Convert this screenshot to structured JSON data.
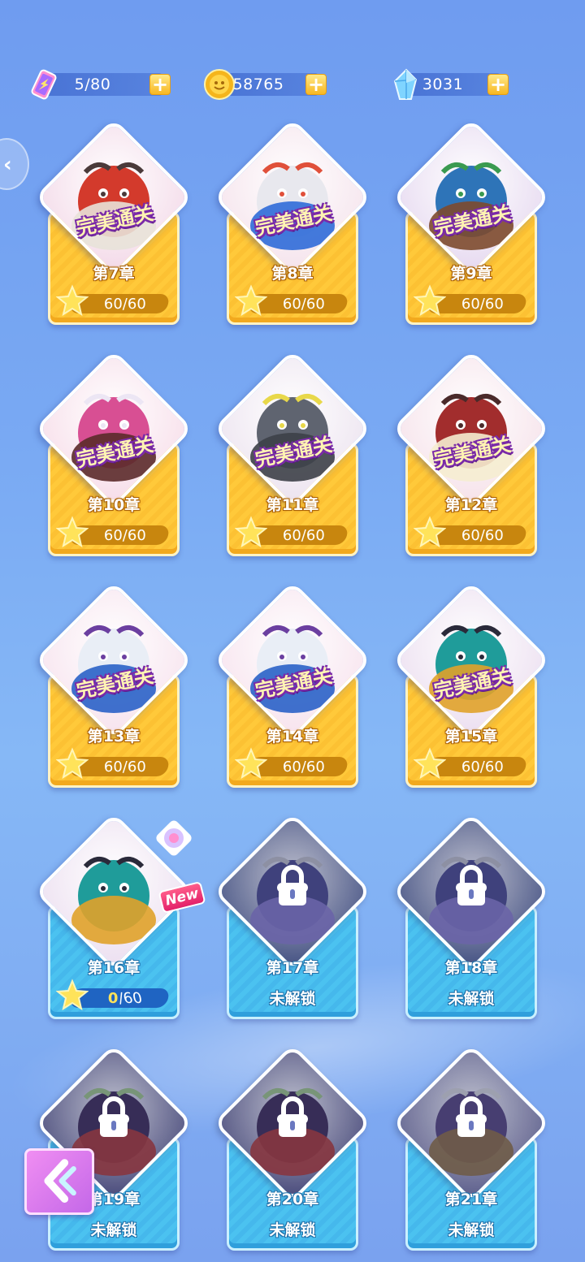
{
  "resources": {
    "energy": {
      "value": "5/80",
      "icon": "energy-scroll-icon"
    },
    "coins": {
      "value": "58765",
      "icon": "coin-icon"
    },
    "gems": {
      "value": "3031",
      "icon": "crystal-icon"
    },
    "plus_label": "+"
  },
  "perfect_label": "完美通关",
  "locked_label": "未解锁",
  "new_label": "New",
  "chapters": [
    {
      "title": "第7章",
      "state": "done",
      "stars": "60/60",
      "creature": "bull-skull-brute"
    },
    {
      "title": "第8章",
      "state": "done",
      "stars": "60/60",
      "creature": "robot-box"
    },
    {
      "title": "第9章",
      "state": "done",
      "stars": "60/60",
      "creature": "antler-bird"
    },
    {
      "title": "第10章",
      "state": "done",
      "stars": "60/60",
      "creature": "pink-ogre"
    },
    {
      "title": "第11章",
      "state": "done",
      "stars": "60/60",
      "creature": "stone-golem"
    },
    {
      "title": "第12章",
      "state": "done",
      "stars": "60/60",
      "creature": "candle-monster"
    },
    {
      "title": "第13章",
      "state": "done",
      "stars": "60/60",
      "creature": "snowman"
    },
    {
      "title": "第14章",
      "state": "done",
      "stars": "60/60",
      "creature": "snowman"
    },
    {
      "title": "第15章",
      "state": "done",
      "stars": "60/60",
      "creature": "witch"
    },
    {
      "title": "第16章",
      "state": "open",
      "stars_current": "0",
      "stars_total": "/60",
      "creature": "witch"
    },
    {
      "title": "第17章",
      "state": "locked",
      "creature": "ghost-wave"
    },
    {
      "title": "第18章",
      "state": "locked",
      "creature": "ghost-wave"
    },
    {
      "title": "第19章",
      "state": "locked",
      "creature": "dragon"
    },
    {
      "title": "第20章",
      "state": "locked",
      "creature": "dragon"
    },
    {
      "title": "第21章",
      "state": "locked",
      "creature": "wizard"
    }
  ],
  "colors": {
    "gold_panel": "#ffc93a",
    "blue_panel": "#4bc2f0",
    "perfect_text": "#fff4b3",
    "perfect_outline": "#7a2aa8"
  }
}
